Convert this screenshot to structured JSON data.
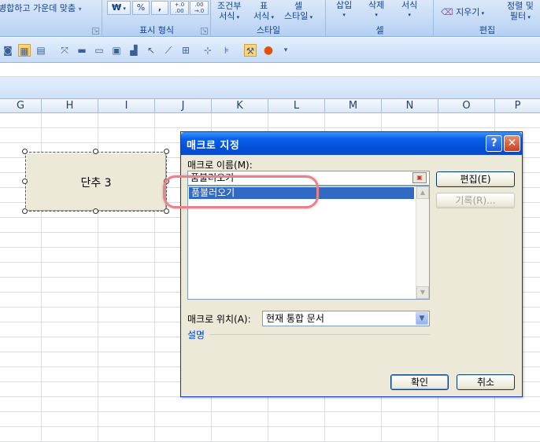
{
  "ribbon": {
    "alignment": {
      "merge_center_label": "병합하고 가운데 맞춤"
    },
    "number": {
      "currency": "₩",
      "percent": "%",
      "comma": ",",
      "inc_decimal": "+.0 .00",
      "dec_decimal": ".00 →.0",
      "group_label": "표시 형식"
    },
    "styles": {
      "conditional_l1": "조건부",
      "conditional_l2": "서식",
      "table_l1": "표",
      "table_l2": "서식",
      "cell_l1": "셀",
      "cell_l2": "스타일",
      "group_label": "스타일"
    },
    "cells": {
      "insert": "삽입",
      "delete": "삭제",
      "format": "서식",
      "group_label": "셀"
    },
    "editing": {
      "clear": "지우기",
      "sort_l1": "정렬 및",
      "sort_l2": "필터",
      "group_label": "편집"
    }
  },
  "columns": [
    "G",
    "H",
    "I",
    "J",
    "K",
    "L",
    "M",
    "N",
    "O",
    "P"
  ],
  "form_button": {
    "label": "단추 3"
  },
  "dialog": {
    "title": "매크로 지정",
    "help_glyph": "?",
    "close_glyph": "✕",
    "macro_name_label": "매크로 이름(M):",
    "macro_name_value": "품불러오기",
    "macro_list": [
      "품불러오기"
    ],
    "edit_button": "편집(E)",
    "record_button": "기록(R)...",
    "location_label": "매크로 위치(A):",
    "location_value": "현재 통합 문서",
    "description_label": "설명",
    "ok_button": "확인",
    "cancel_button": "취소"
  }
}
